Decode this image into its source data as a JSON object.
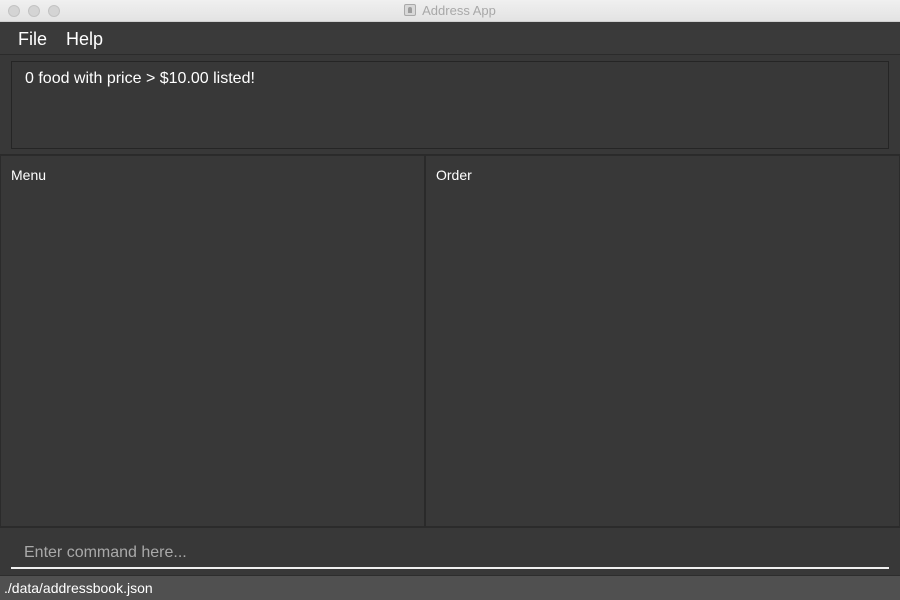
{
  "window": {
    "title": "Address App",
    "icon": "app-icon"
  },
  "menubar": {
    "items": [
      {
        "label": "File"
      },
      {
        "label": "Help"
      }
    ]
  },
  "result_display": {
    "text": "0 food with price > $10.00 listed!"
  },
  "panels": {
    "menu": {
      "title": "Menu"
    },
    "order": {
      "title": "Order"
    }
  },
  "command_box": {
    "value": "",
    "placeholder": "Enter command here..."
  },
  "status_bar": {
    "path": "./data/addressbook.json"
  },
  "colors": {
    "background": "#383838",
    "status_bar": "#505050",
    "text": "#ffffff"
  }
}
